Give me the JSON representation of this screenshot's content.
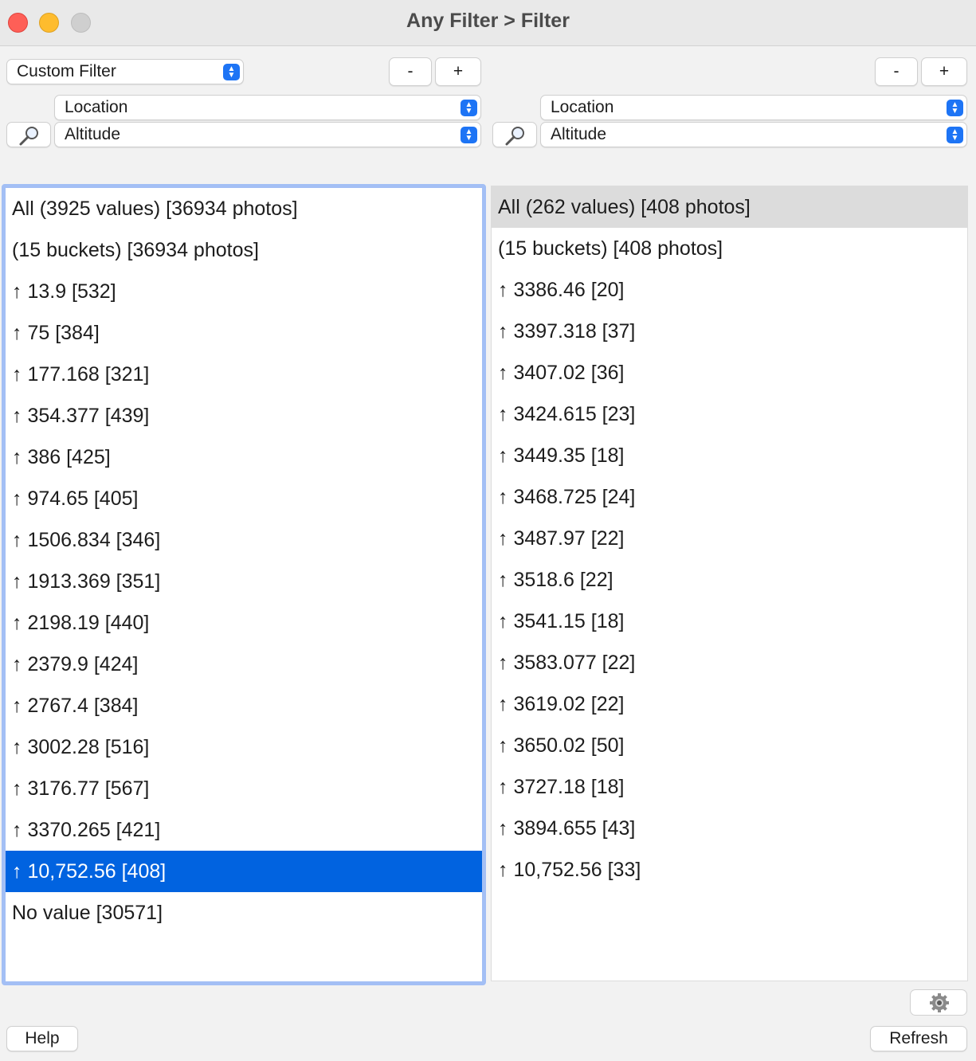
{
  "window": {
    "title": "Any Filter > Filter"
  },
  "left": {
    "filter_type": "Custom Filter",
    "minus_label": "-",
    "plus_label": "+",
    "field1": "Location",
    "field2": "Altitude",
    "rows": [
      "All (3925 values) [36934 photos]",
      "(15 buckets) [36934 photos]",
      "↑ 13.9 [532]",
      "↑ 75 [384]",
      "↑ 177.168 [321]",
      "↑ 354.377 [439]",
      "↑ 386 [425]",
      "↑ 974.65 [405]",
      "↑ 1506.834 [346]",
      "↑ 1913.369 [351]",
      "↑ 2198.19 [440]",
      "↑ 2379.9 [424]",
      "↑ 2767.4 [384]",
      "↑ 3002.28 [516]",
      "↑ 3176.77 [567]",
      "↑ 3370.265 [421]",
      "↑ 10,752.56 [408]",
      "No value [30571]"
    ]
  },
  "right": {
    "minus_label": "-",
    "plus_label": "+",
    "field1": "Location",
    "field2": "Altitude",
    "rows": [
      "All (262 values) [408 photos]",
      "(15 buckets) [408 photos]",
      "↑ 3386.46 [20]",
      "↑ 3397.318 [37]",
      "↑ 3407.02 [36]",
      "↑ 3424.615 [23]",
      "↑ 3449.35 [18]",
      "↑ 3468.725 [24]",
      "↑ 3487.97 [22]",
      "↑ 3518.6 [22]",
      "↑ 3541.15 [18]",
      "↑ 3583.077 [22]",
      "↑ 3619.02 [22]",
      "↑ 3650.02 [50]",
      "↑ 3727.18 [18]",
      "↑ 3894.655 [43]",
      "↑ 10,752.56 [33]"
    ]
  },
  "footer": {
    "help_label": "Help",
    "refresh_label": "Refresh"
  },
  "colors": {
    "selection": "#0163e0",
    "focus_ring": "#a3bff5",
    "accent": "#1d74f5"
  },
  "icons": [
    "search-icon",
    "gear-icon",
    "popup-arrows-icon"
  ]
}
